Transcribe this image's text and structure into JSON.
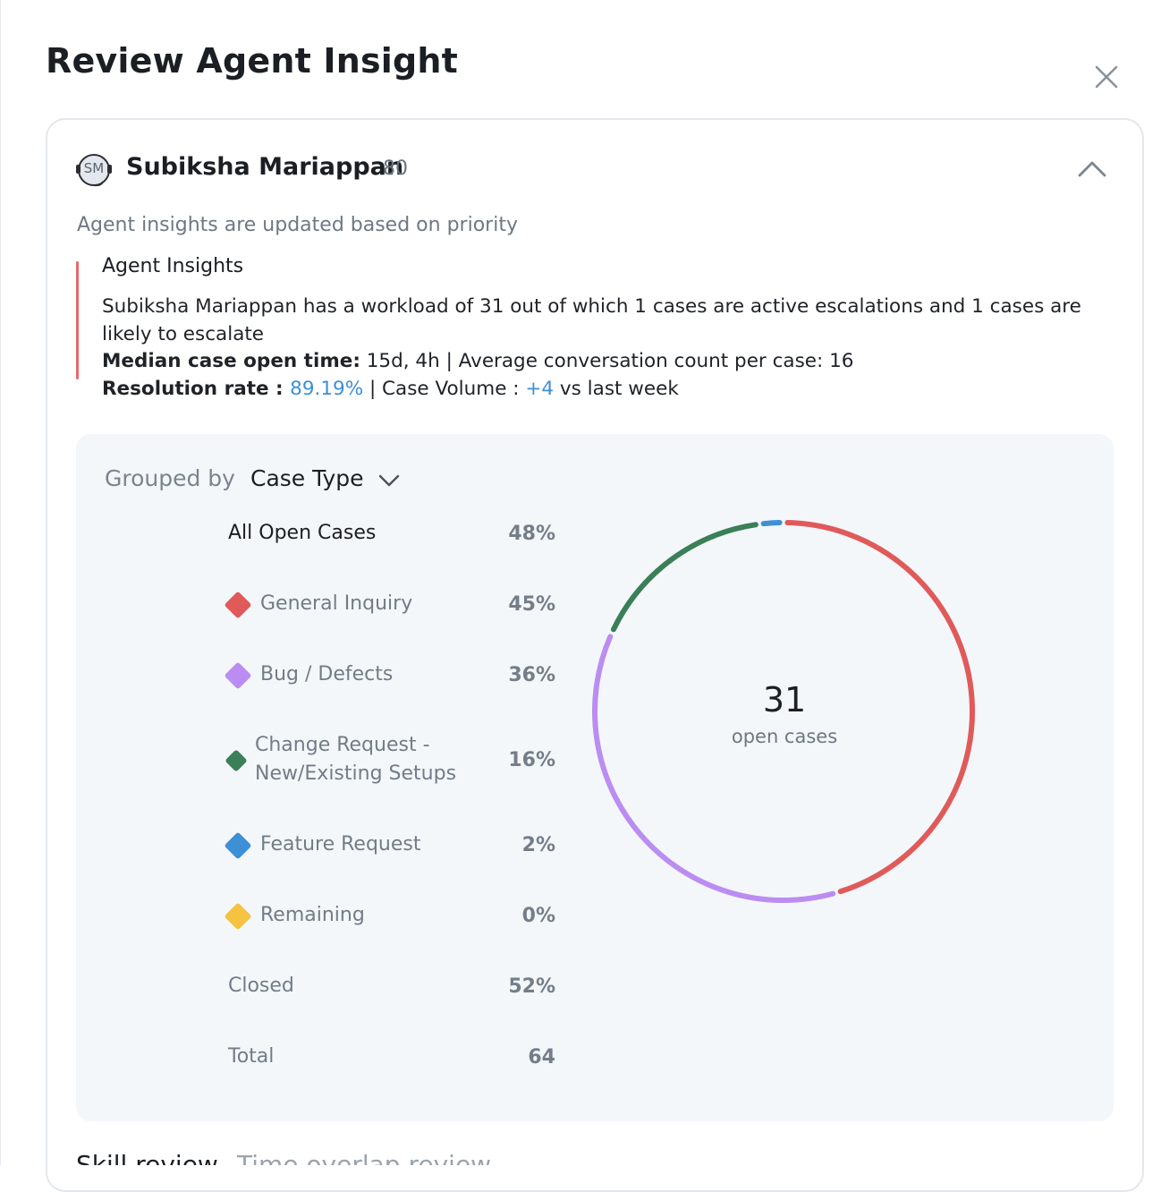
{
  "modal": {
    "title": "Review Agent Insight"
  },
  "agent": {
    "initials": "SM",
    "name": "Subiksha Mariappan",
    "score": "80"
  },
  "subtitle": "Agent insights are updated based on priority",
  "insights": {
    "heading": "Agent Insights",
    "summary": "Subiksha Mariappan has a workload of 31 out of which 1 cases are active escalations and 1 cases are likely to escalate",
    "median_label": "Median case open time:",
    "median_value": " 15d, 4h | Average conversation count per case: 16",
    "resolution_label": "Resolution rate : ",
    "resolution_value": "89.19%",
    "volume_label": " | Case Volume : ",
    "volume_value": "+4",
    "volume_suffix": " vs last week"
  },
  "grouping": {
    "label": "Grouped by",
    "value": "Case Type"
  },
  "legend": {
    "all_open": {
      "label": "All Open Cases",
      "pct": "48%"
    },
    "items": [
      {
        "label": "General Inquiry",
        "pct": "45%",
        "color": "#e05a5a"
      },
      {
        "label": "Bug / Defects",
        "pct": "36%",
        "color": "#bb8df2"
      },
      {
        "label": "Change Request -",
        "label2": "New/Existing Setups",
        "pct": "16%",
        "color": "#3a7f57"
      },
      {
        "label": "Feature Request",
        "pct": "2%",
        "color": "#3d8fd6"
      },
      {
        "label": "Remaining",
        "pct": "0%",
        "color": "#f5c242"
      }
    ],
    "closed": {
      "label": "Closed",
      "pct": "52%"
    },
    "total": {
      "label": "Total",
      "pct": "64"
    }
  },
  "chart_data": {
    "type": "pie",
    "title": "",
    "center_value": "31",
    "center_label": "open cases",
    "categories": [
      "General Inquiry",
      "Bug / Defects",
      "Change Request - New/Existing Setups",
      "Feature Request",
      "Remaining"
    ],
    "values": [
      45,
      36,
      16,
      2,
      0
    ],
    "colors": [
      "#e05a5a",
      "#bb8df2",
      "#3a7f57",
      "#3d8fd6",
      "#f5c242"
    ]
  },
  "tabs": [
    {
      "label": "Skill review",
      "active": true
    },
    {
      "label": "Time overlap review",
      "active": false
    }
  ]
}
